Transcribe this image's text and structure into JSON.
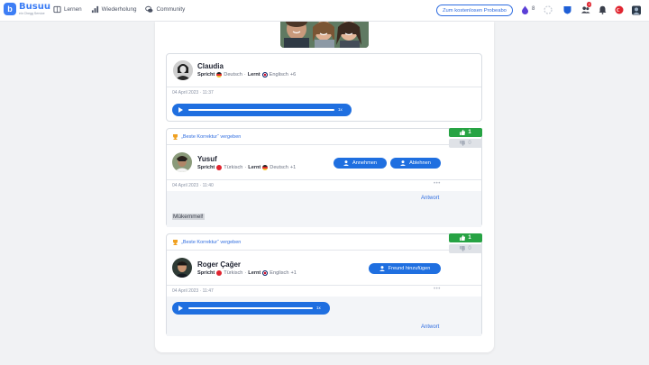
{
  "app": {
    "logo_name": "Busuu",
    "logo_sub": "ein Chegg Service",
    "nav": [
      {
        "label": "Lernen",
        "icon": "book-icon"
      },
      {
        "label": "Wiederholung",
        "icon": "bar-chart-icon"
      },
      {
        "label": "Community",
        "icon": "chat-icon"
      }
    ],
    "trial_button": "Zum kostenlosen Probeabo",
    "gems_count": "8",
    "friends_badge": "4",
    "colors": {
      "brand": "#3d7ef5",
      "button": "#1f6fe0",
      "upvote": "#27a344"
    }
  },
  "post": {
    "user": "Claudia",
    "spricht_label": "Spricht",
    "speaks": "Deutsch",
    "lernt_label": "Lernt",
    "learns": "Englisch",
    "more_langs": "+6",
    "date": "04 April 2023 · 11:37",
    "audio_speed": "1x"
  },
  "comments": [
    {
      "best_label": "„Beste Korrektur“ vergeben",
      "user": "Yusuf",
      "spricht_label": "Spricht",
      "speaks": "Türkisch",
      "lernt_label": "Lernt",
      "learns": "Deutsch",
      "more_langs": "+1",
      "accept_label": "Annehmen",
      "decline_label": "Ablehnen",
      "date": "04 April 2023 · 11:40",
      "more": "•••",
      "answer_label": "Antwort",
      "text": "Mükemmel!",
      "upvotes": "1",
      "downvotes": "0"
    },
    {
      "best_label": "„Beste Korrektur“ vergeben",
      "user": "Roger Çağer",
      "spricht_label": "Spricht",
      "speaks": "Türkisch",
      "lernt_label": "Lernt",
      "learns": "Englisch",
      "more_langs": "+1",
      "add_friend_label": "Freund hinzufügen",
      "date": "04 April 2023 · 11:47",
      "more": "•••",
      "audio_speed": "1x",
      "answer_label": "Antwort",
      "upvotes": "1",
      "downvotes": "0"
    }
  ]
}
